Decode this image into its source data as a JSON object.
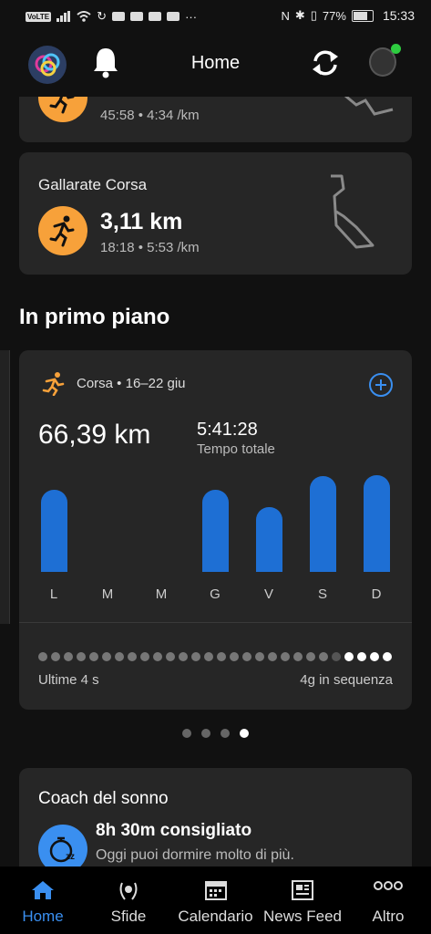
{
  "status_bar": {
    "carrier": "VoLTE",
    "battery": "77%",
    "time": "15:33",
    "more": "···"
  },
  "header": {
    "title": "Home"
  },
  "activities": [
    {
      "title": "",
      "sub": "45:58 • 4:34 /km"
    },
    {
      "title": "Gallarate Corsa",
      "distance": "3,11 km",
      "sub": "18:18 • 5:53 /km"
    }
  ],
  "featured": {
    "section_title": "In primo piano",
    "card": {
      "label": "Corsa • 16–22 giu",
      "distance": "66,39 km",
      "time": "5:41:28",
      "time_label": "Tempo totale",
      "streak_left": "Ultime 4 s",
      "streak_right": "4g in sequenza",
      "streak_total_days": 28,
      "streak_active_days": 4
    },
    "pager": {
      "pages": 4,
      "active": 3
    }
  },
  "chart_data": {
    "type": "bar",
    "categories": [
      "L",
      "M",
      "M",
      "G",
      "V",
      "S",
      "D"
    ],
    "values": [
      9.0,
      0,
      0,
      9.0,
      7.1,
      10.5,
      10.6
    ]
  },
  "sleep_coach": {
    "title": "Coach del sonno",
    "headline": "8h 30m consigliato",
    "sub": "Oggi puoi dormire molto di più."
  },
  "nav": {
    "items": [
      "Home",
      "Sfide",
      "Calendario",
      "News Feed",
      "Altro"
    ],
    "active": 0
  },
  "colors": {
    "accent": "#1e6fd4",
    "orange": "#f7a13a",
    "nav_active": "#3a8ff0"
  }
}
